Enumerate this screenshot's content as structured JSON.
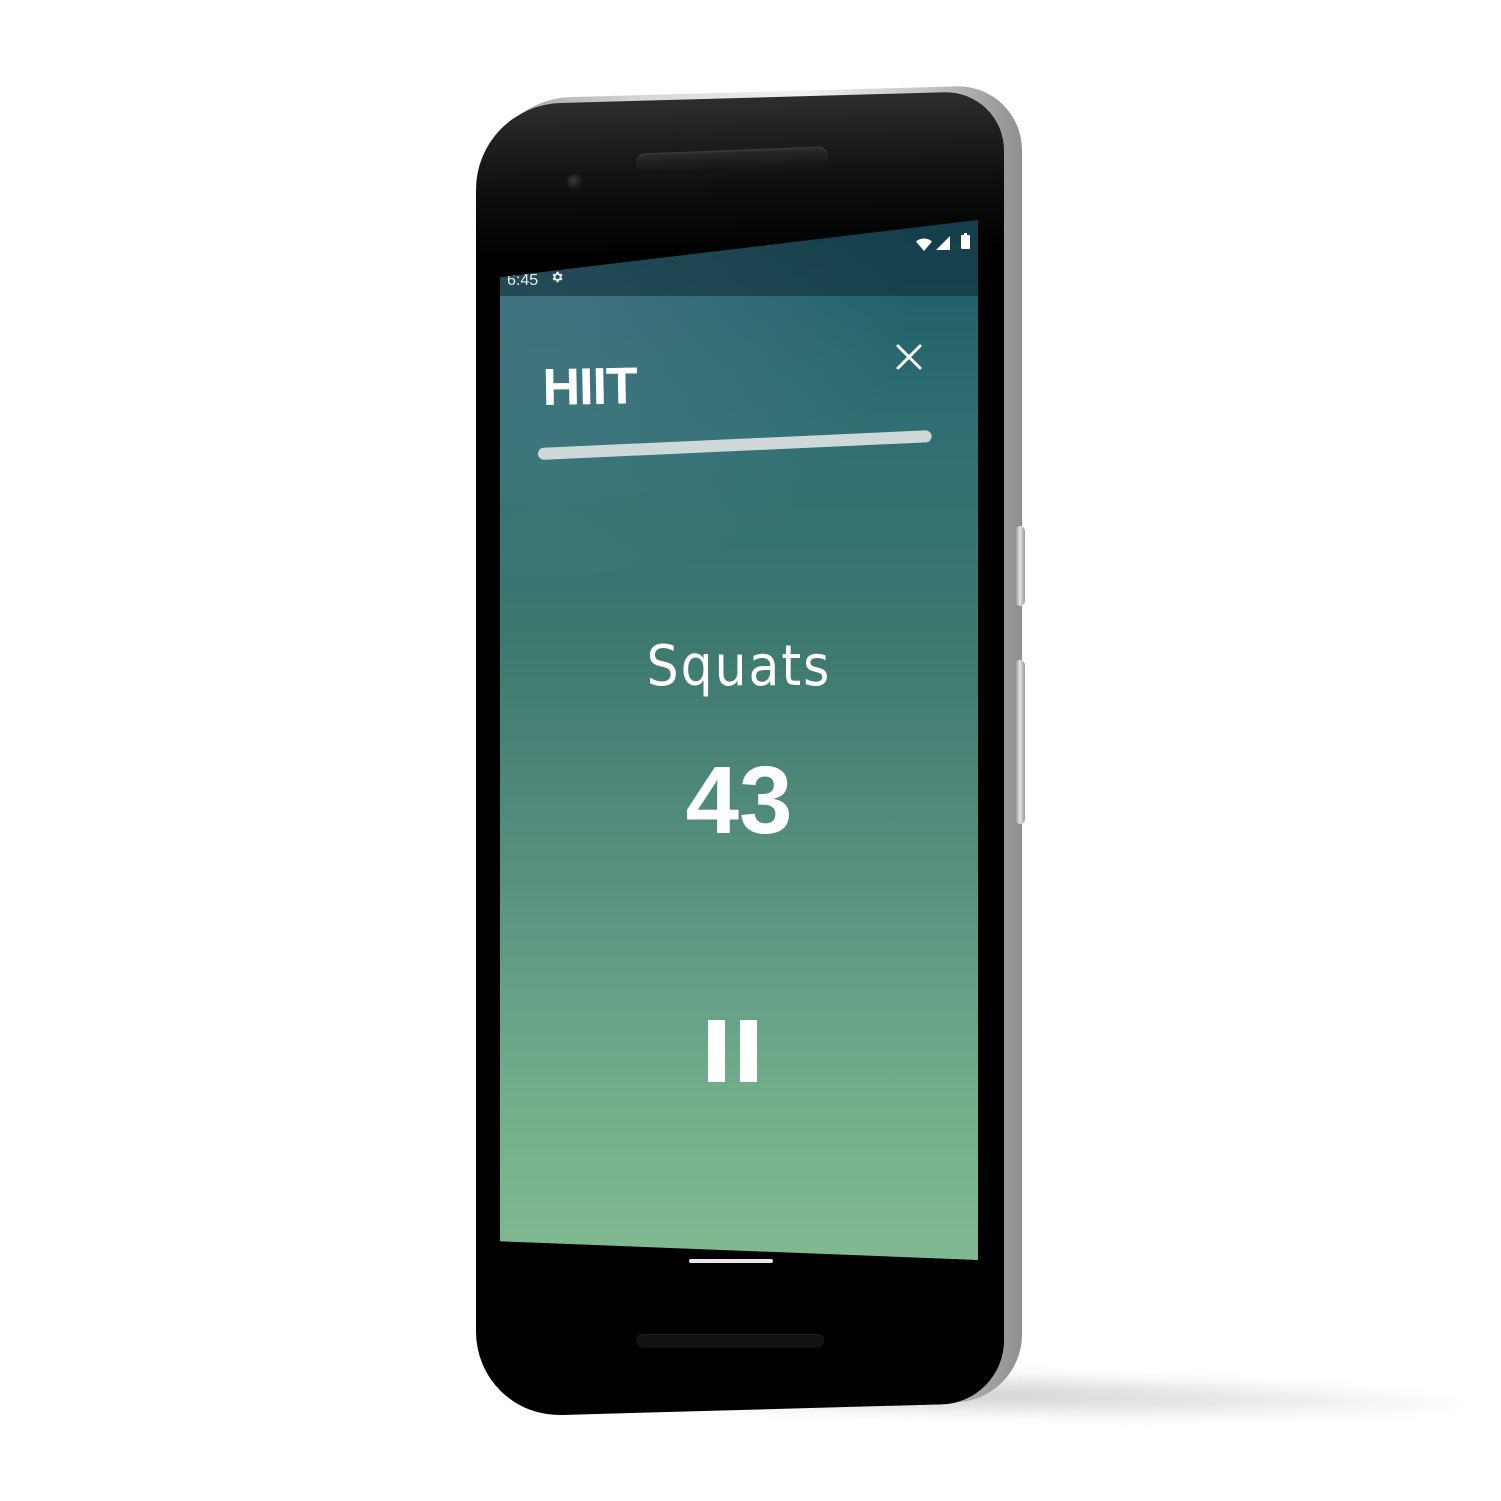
{
  "status_bar": {
    "time": "6:45",
    "icons": [
      "settings-icon",
      "wifi-icon",
      "signal-icon",
      "battery-icon"
    ]
  },
  "workout": {
    "title": "HIIT",
    "progress_percent": 100,
    "exercise": "Squats",
    "count": "43"
  },
  "controls": {
    "close_icon": "close-icon",
    "pause_icon": "pause-icon"
  },
  "colors": {
    "gradient_top": "#1d5a66",
    "gradient_bottom": "#80b991",
    "text": "#ffffff",
    "progress": "#cfd8d8"
  }
}
